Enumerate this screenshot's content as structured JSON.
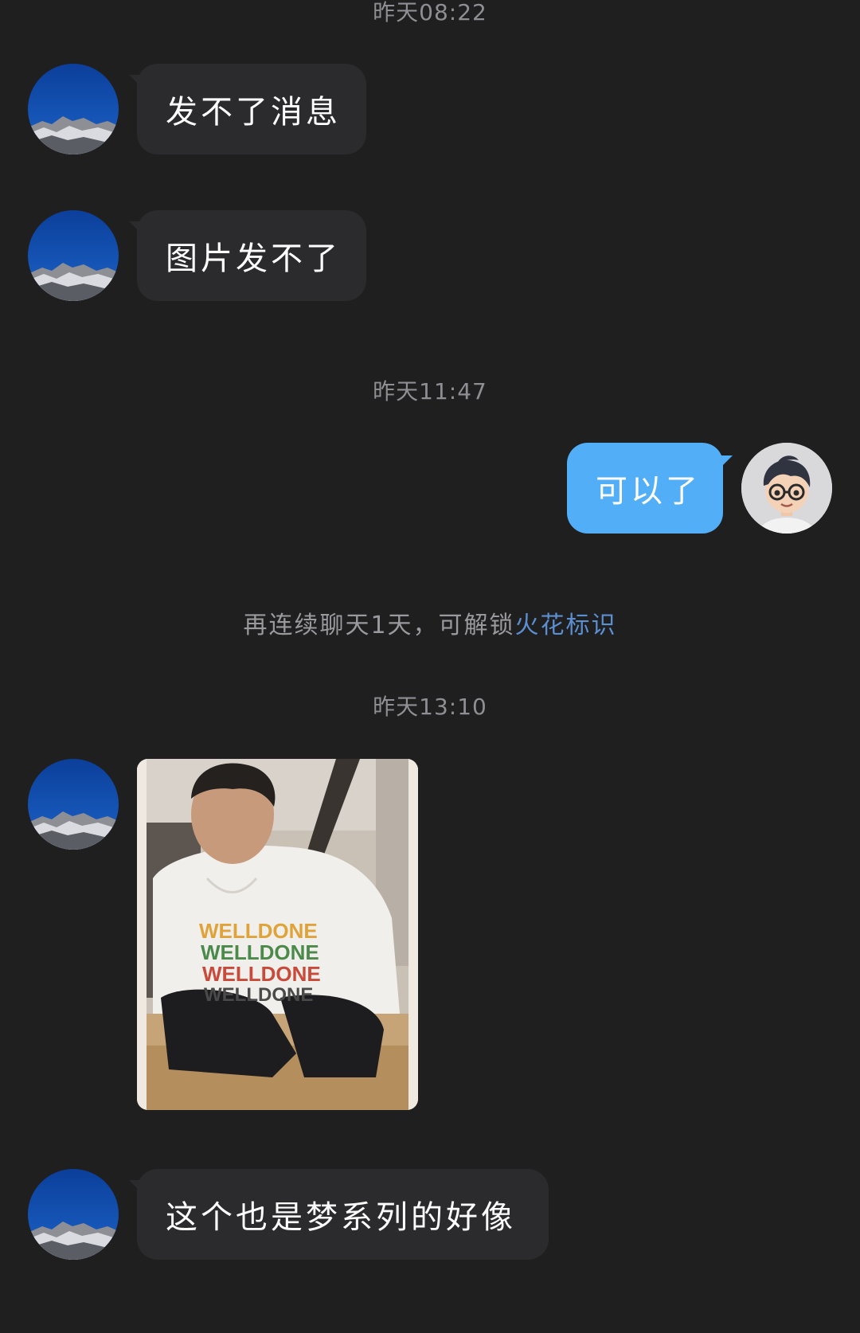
{
  "timestamps": [
    "昨天08:22",
    "昨天11:47",
    "昨天13:10"
  ],
  "messages": [
    {
      "side": "in",
      "text": "发不了消息"
    },
    {
      "side": "in",
      "text": "图片发不了"
    },
    {
      "side": "out",
      "text": "可以了"
    },
    {
      "side": "in",
      "type": "image",
      "shirt_text": [
        "WELLDONE",
        "WELLDONE",
        "WELLDONE",
        "WELLDONE"
      ]
    },
    {
      "side": "in",
      "text": "这个也是梦系列的好像"
    }
  ],
  "notice": {
    "text": "再连续聊天1天，可解锁",
    "link": "火花标识"
  },
  "colors": {
    "background": "#1f1f20",
    "incoming_bubble": "#2b2b2d",
    "outgoing_bubble": "#52aef6",
    "timestamp": "#8e8e93",
    "notice_link": "#5b8fd0"
  },
  "icons": {
    "contact_avatar": "mountain-sky-avatar",
    "self_avatar": "cartoon-boy-glasses-avatar"
  }
}
